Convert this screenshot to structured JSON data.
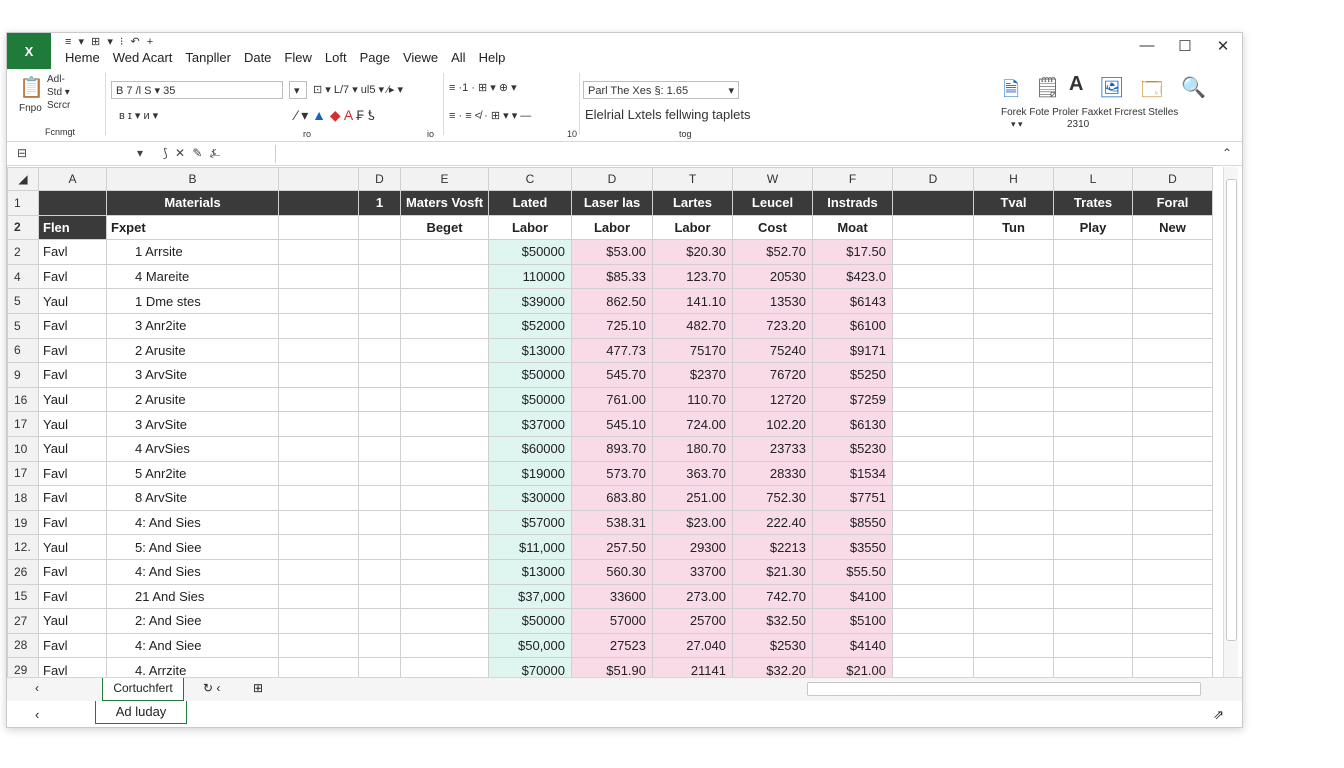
{
  "app": {
    "icon_label": "X"
  },
  "qat": {
    "icons": "≡ ▾  ⊞ ▾  ⁝ ↶  +"
  },
  "menu": [
    "Heme",
    "Wed Acart",
    "Tanpller",
    "Date",
    "Flew",
    "Loft",
    "Page",
    "Viewe",
    "All",
    "Help"
  ],
  "window_controls": {
    "minimize": "—",
    "maximize": "☐",
    "close": "✕"
  },
  "ribbon": {
    "paste_lines": [
      "Adl-",
      "Std ▾",
      "Scrcr",
      "Fnpo"
    ],
    "font_group_label": "Fcnmgt",
    "font_name": "B  7  /l  S ▾  35",
    "font_row2": "ʙ   ɪ   ▾   и   ▾",
    "size_controls": "⊡ ▾   L/7 ▾   ul5 ▾  ⁄▸ ▾",
    "align_row1": "≡ ·1 ·  ⊞ ▾  ⊕ ▾",
    "align_row2": "≡ ·  ≡  ≮ ·  ⊞ ▾   ▾   —",
    "group_num1": "ro",
    "group_num2": "io",
    "group_num3": "10",
    "number_format": "Parl The Xes §: 1.65",
    "style_text": "Elelrial Lxtels fellwing taplets",
    "style_group": "tog",
    "right_labels": "Forek Fote Proler Faxket Frcrest Stelles",
    "right_sub": "2310",
    "right_carets": "▾   ▾"
  },
  "formula_bar": {
    "name_box": "⊟",
    "icons": "⟆   ✕   ✎   ⍼",
    "expand": "⌃"
  },
  "columns": [
    "A",
    "B",
    "",
    "D",
    "E",
    "C",
    "D",
    "T",
    "W",
    "F",
    "D",
    "H",
    "L",
    "D"
  ],
  "header_row1": {
    "row": "1",
    "b": "Materials",
    "d": "1",
    "e": "Maters Vosft",
    "f": "Lated",
    "g": "Laser las",
    "h": "Lartes",
    "i": "Leucel",
    "j": "Instrads",
    "l": "Tval",
    "m": "Trates",
    "n": "Foral"
  },
  "header_row2": {
    "row": "2",
    "a": "Flen",
    "b": "Fxpet",
    "e": "Beget",
    "f": "Labor",
    "g": "Labor",
    "h": "Labor",
    "i": "Cost",
    "j": "Moat",
    "l": "Tun",
    "m": "Play",
    "n": "New"
  },
  "rows": [
    {
      "row": "2",
      "a": "Favl",
      "b": "1 Arrsite",
      "f": "$50000",
      "g": "$53.00",
      "h": "$20.30",
      "i": "$52.70",
      "j": "$17.50"
    },
    {
      "row": "4",
      "a": "Favl",
      "b": "4 Mareite",
      "f": "110000",
      "g": "$85.33",
      "h": "123.70",
      "i": "20530",
      "j": "$423.0"
    },
    {
      "row": "5",
      "a": "Yaul",
      "b": "1 Dme stes",
      "f": "$39000",
      "g": "862.50",
      "h": "141.10",
      "i": "13530",
      "j": "$6143"
    },
    {
      "row": "5",
      "a": "Favl",
      "b": "3 Anr2ite",
      "f": "$52000",
      "g": "725.10",
      "h": "482.70",
      "i": "723.20",
      "j": "$6100"
    },
    {
      "row": "6",
      "a": "Favl",
      "b": "2 Arusite",
      "f": "$13000",
      "g": "477.73",
      "h": "75170",
      "i": "75240",
      "j": "$9171"
    },
    {
      "row": "9",
      "a": "Favl",
      "b": "3 ArvSite",
      "f": "$50000",
      "g": "545.70",
      "h": "$2370",
      "i": "76720",
      "j": "$5250"
    },
    {
      "row": "16",
      "a": "Yaul",
      "b": "2 Arusite",
      "f": "$50000",
      "g": "761.00",
      "h": "110.70",
      "i": "12720",
      "j": "$7259"
    },
    {
      "row": "17",
      "a": "Yaul",
      "b": "3 ArvSite",
      "f": "$37000",
      "g": "545.10",
      "h": "724.00",
      "i": "102.20",
      "j": "$6130"
    },
    {
      "row": "10",
      "a": "Yaul",
      "b": "4 ArvSies",
      "f": "$60000",
      "g": "893.70",
      "h": "180.70",
      "i": "23733",
      "j": "$5230"
    },
    {
      "row": "17",
      "a": "Favl",
      "b": "5 Anr2ite",
      "f": "$19000",
      "g": "573.70",
      "h": "363.70",
      "i": "28330",
      "j": "$1534"
    },
    {
      "row": "18",
      "a": "Favl",
      "b": "8 ArvSite",
      "f": "$30000",
      "g": "683.80",
      "h": "251.00",
      "i": "752.30",
      "j": "$7751"
    },
    {
      "row": "19",
      "a": "Favl",
      "b": "4: And Sies",
      "f": "$57000",
      "g": "538.31",
      "h": "$23.00",
      "i": "222.40",
      "j": "$8550"
    },
    {
      "row": "12.",
      "a": "Yaul",
      "b": "5: And Siee",
      "f": "$11,000",
      "g": "257.50",
      "h": "29300",
      "i": "$2213",
      "j": "$3550"
    },
    {
      "row": "26",
      "a": "Favl",
      "b": "4: And Sies",
      "f": "$13000",
      "g": "560.30",
      "h": "33700",
      "i": "$21.30",
      "j": "$55.50"
    },
    {
      "row": "15",
      "a": "Favl",
      "b": "21 And Sies",
      "f": "$37,000",
      "g": "33600",
      "h": "273.00",
      "i": "742.70",
      "j": "$4100"
    },
    {
      "row": "27",
      "a": "Yaul",
      "b": "2: And Siee",
      "f": "$50000",
      "g": "57000",
      "h": "25700",
      "i": "$32.50",
      "j": "$5100"
    },
    {
      "row": "28",
      "a": "Favl",
      "b": "4: And Siee",
      "f": "$50,000",
      "g": "27523",
      "h": "27.040",
      "i": "$2530",
      "j": "$4140"
    },
    {
      "row": "29",
      "a": "Favl",
      "b": "4. Arrzite",
      "f": "$70000",
      "g": "$51.90",
      "h": "21141",
      "i": "$32.20",
      "j": "$21.00"
    }
  ],
  "sheet_tabs": {
    "active": "Cortuchfert",
    "nav_left": "‹",
    "extra": "↻ ‹",
    "add": "⊞"
  },
  "status_bar": {
    "left": "‹",
    "text": "Ad luday",
    "right": "⇗"
  },
  "colors": {
    "accent": "#1e7b3a",
    "header_dark": "#3a3a3a",
    "green_fill": "#dff5ef",
    "pink_fill": "#f9dbe8"
  }
}
